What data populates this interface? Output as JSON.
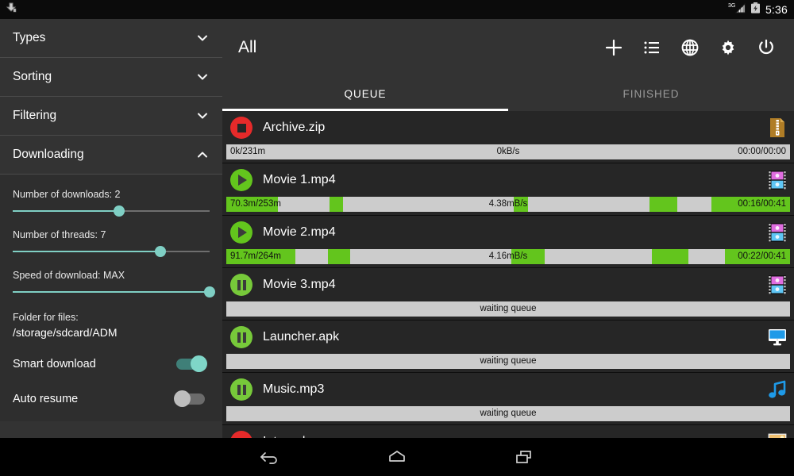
{
  "statusbar": {
    "left_icon": "download-notification-icon",
    "network_label": "3G",
    "signal_icon": "signal-bars-icon",
    "battery_icon": "battery-charging-icon",
    "time": "5:36"
  },
  "sidebar": {
    "sections": [
      {
        "label": "Types",
        "icon": "chevron-down-icon",
        "expanded": false
      },
      {
        "label": "Sorting",
        "icon": "chevron-down-icon",
        "expanded": false
      },
      {
        "label": "Filtering",
        "icon": "chevron-down-icon",
        "expanded": false
      },
      {
        "label": "Downloading",
        "icon": "chevron-up-icon",
        "expanded": true
      }
    ],
    "downloading": {
      "sliders": [
        {
          "label": "Number of downloads: 2",
          "percent": 54
        },
        {
          "label": "Number of threads: 7",
          "percent": 75
        },
        {
          "label": "Speed of download: MAX",
          "percent": 100
        }
      ],
      "folder_label": "Folder for files:",
      "folder_path": "/storage/sdcard/ADM",
      "switches": [
        {
          "label": "Smart download",
          "on": true
        },
        {
          "label": "Auto resume",
          "on": false
        }
      ]
    }
  },
  "appbar": {
    "title": "All",
    "actions": [
      {
        "name": "add-download-button",
        "icon": "plus-icon"
      },
      {
        "name": "list-view-button",
        "icon": "list-icon"
      },
      {
        "name": "browser-button",
        "icon": "globe-icon"
      },
      {
        "name": "settings-button",
        "icon": "gear-icon"
      },
      {
        "name": "exit-button",
        "icon": "power-icon"
      }
    ]
  },
  "tabs": {
    "items": [
      {
        "label": "QUEUE",
        "active": true
      },
      {
        "label": "FINISHED",
        "active": false
      }
    ]
  },
  "downloads": [
    {
      "name": "Archive.zip",
      "state": "stopped",
      "state_icon": "stop-icon",
      "file_icon": "zip-file-icon",
      "progress": {
        "type": "detail",
        "left": "0k/231m",
        "mid": "0kB/s",
        "right": "00:00/00:00",
        "segments": []
      }
    },
    {
      "name": "Movie 1.mp4",
      "state": "downloading",
      "state_icon": "play-icon",
      "file_icon": "video-file-icon",
      "progress": {
        "type": "detail",
        "left": "70.3m/253m",
        "mid": "4.38mB/s",
        "right": "00:16/00:41",
        "segments": [
          {
            "start": 0.0,
            "width": 9.1
          },
          {
            "start": 18.3,
            "width": 2.4
          },
          {
            "start": 51.0,
            "width": 2.5
          },
          {
            "start": 75.0,
            "width": 5.0
          },
          {
            "start": 86.0,
            "width": 14.0
          }
        ]
      }
    },
    {
      "name": "Movie 2.mp4",
      "state": "downloading",
      "state_icon": "play-icon",
      "file_icon": "video-file-icon",
      "progress": {
        "type": "detail",
        "left": "91.7m/264m",
        "mid": "4.16mB/s",
        "right": "00:22/00:41",
        "segments": [
          {
            "start": 0.0,
            "width": 12.2
          },
          {
            "start": 18.0,
            "width": 4.0
          },
          {
            "start": 50.5,
            "width": 6.0
          },
          {
            "start": 75.5,
            "width": 6.5
          },
          {
            "start": 88.5,
            "width": 11.5
          }
        ]
      }
    },
    {
      "name": "Movie 3.mp4",
      "state": "paused",
      "state_icon": "pause-icon",
      "file_icon": "video-file-icon",
      "progress": {
        "type": "waiting",
        "mid": "waiting queue",
        "segments": []
      }
    },
    {
      "name": "Launcher.apk",
      "state": "paused",
      "state_icon": "pause-icon",
      "file_icon": "apk-file-icon",
      "progress": {
        "type": "waiting",
        "mid": "waiting queue",
        "segments": []
      }
    },
    {
      "name": "Music.mp3",
      "state": "paused",
      "state_icon": "pause-icon",
      "file_icon": "audio-file-icon",
      "progress": {
        "type": "waiting",
        "mid": "waiting queue",
        "segments": []
      }
    },
    {
      "name": "Internal.png",
      "state": "stopped",
      "state_icon": "stop-icon",
      "file_icon": "image-file-icon",
      "progress": {
        "type": "none",
        "segments": []
      }
    }
  ],
  "navbar": {
    "buttons": [
      {
        "name": "back-button",
        "icon": "back-arrow-icon"
      },
      {
        "name": "home-button",
        "icon": "home-icon"
      },
      {
        "name": "recents-button",
        "icon": "recents-icon"
      }
    ]
  },
  "colors": {
    "accent_green": "#63c51d",
    "accent_teal": "#7fcfc4",
    "stop_red": "#e62a2a",
    "drawer_bg": "#333333",
    "panel_bg": "#2e2e2e",
    "row_bg": "#262626",
    "progress_bg": "#cccccc"
  }
}
